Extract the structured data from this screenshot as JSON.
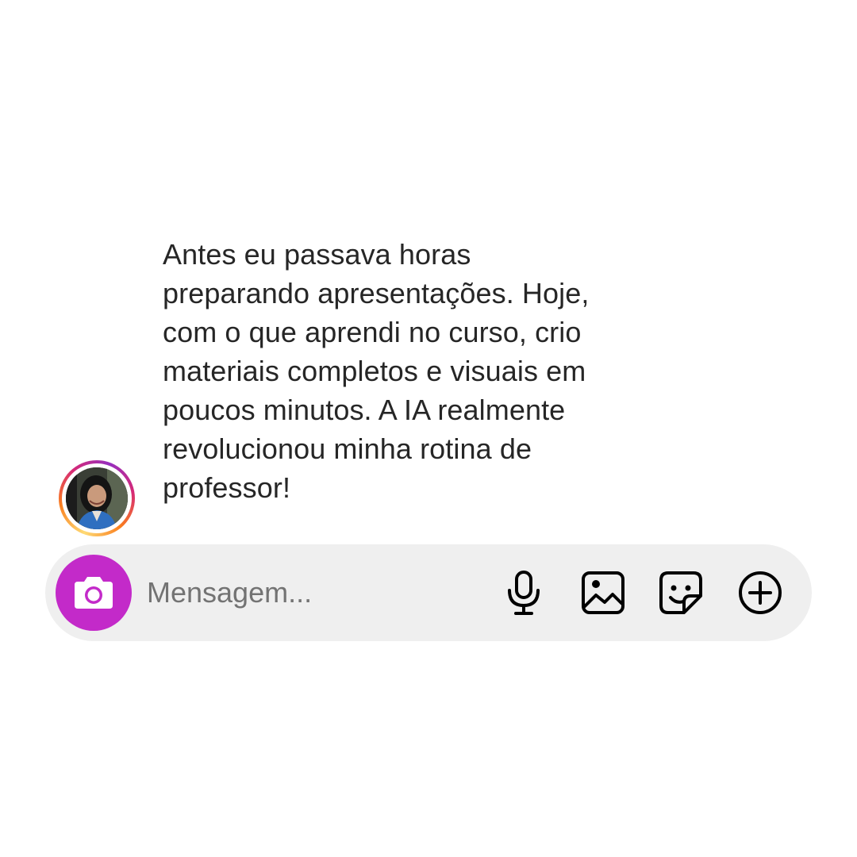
{
  "message": {
    "text": "Antes eu passava horas\npreparando apresentações. Hoje,\ncom o que aprendi no curso, crio\nmateriais completos e visuais em\npoucos minutos. A IA realmente\nrevolucionou minha rotina de\nprofessor!"
  },
  "composer": {
    "placeholder": "Mensagem...",
    "camera_icon": "camera-icon",
    "tools": [
      "microphone-icon",
      "gallery-icon",
      "sticker-icon",
      "plus-circle-icon"
    ]
  },
  "colors": {
    "camera_button": "#c32ac9",
    "composer_background": "#efefef",
    "text": "#262626",
    "placeholder": "#737373"
  }
}
